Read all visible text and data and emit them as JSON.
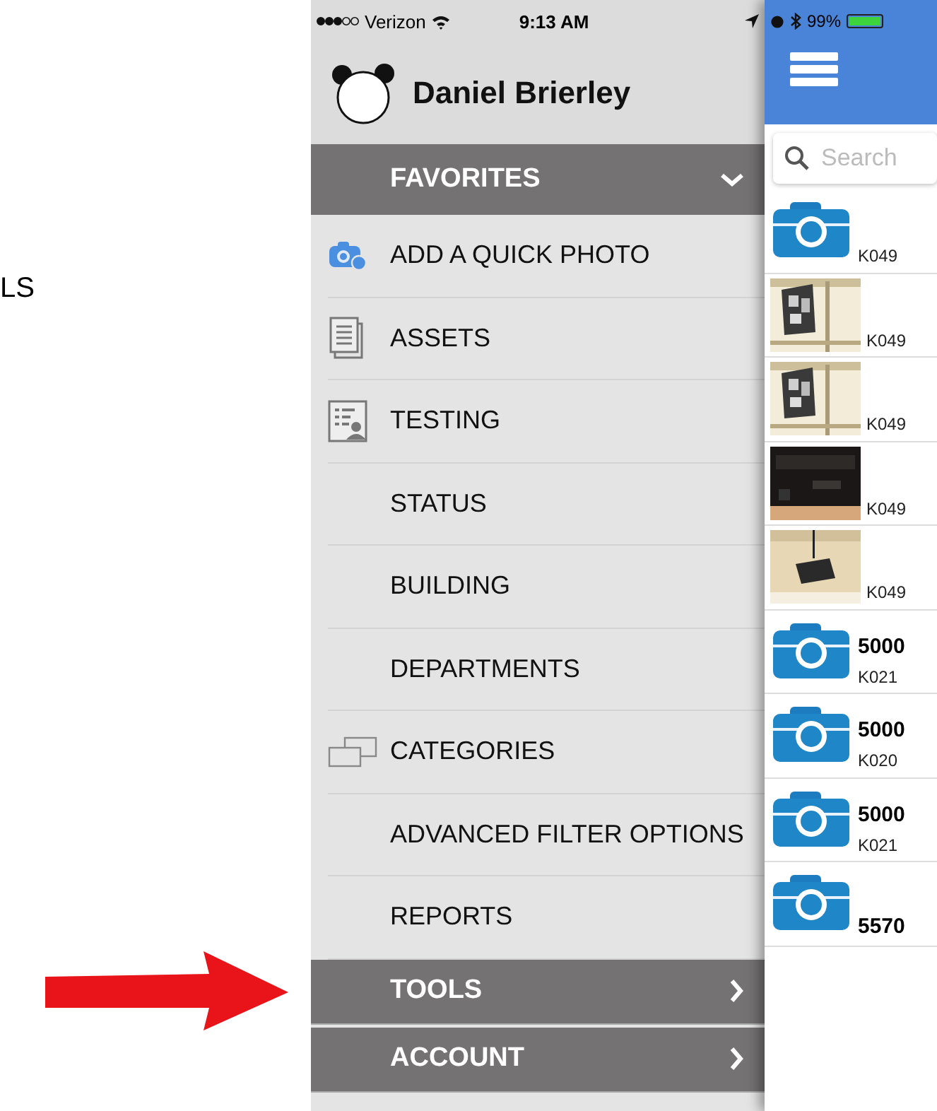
{
  "side_note": {
    "text": "LS"
  },
  "status_bar": {
    "carrier": "Verizon",
    "time": "9:13 AM",
    "battery": "99%",
    "level": 0.99
  },
  "profile": {
    "name": "Daniel Brierley"
  },
  "favorites": {
    "label": "FAVORITES",
    "expanded": true
  },
  "menu_items": [
    {
      "label": "ADD A QUICK PHOTO"
    },
    {
      "label": "ASSETS"
    },
    {
      "label": "TESTING"
    },
    {
      "label": "STATUS"
    },
    {
      "label": "BUILDING"
    },
    {
      "label": "DEPARTMENTS"
    },
    {
      "label": "CATEGORIES"
    },
    {
      "label": "ADVANCED FILTER OPTIONS"
    },
    {
      "label": "REPORTS"
    }
  ],
  "sections": [
    {
      "label": "TOOLS",
      "expanded": false
    },
    {
      "label": "ACCOUNT",
      "expanded": false
    }
  ],
  "search": {
    "placeholder": "Search"
  },
  "asset_rows": [
    {
      "kind": "camera",
      "code": "K049"
    },
    {
      "kind": "picture",
      "code": "K049"
    },
    {
      "kind": "picture",
      "code": "K049"
    },
    {
      "kind": "picture",
      "code": "K049"
    },
    {
      "kind": "picture",
      "code": "K049"
    },
    {
      "kind": "camera",
      "title": "5000",
      "code": "K021"
    },
    {
      "kind": "camera",
      "title": "5000",
      "code": "K020"
    },
    {
      "kind": "camera",
      "title": "5000",
      "code": "K021"
    },
    {
      "kind": "camera",
      "title": "5570"
    }
  ]
}
